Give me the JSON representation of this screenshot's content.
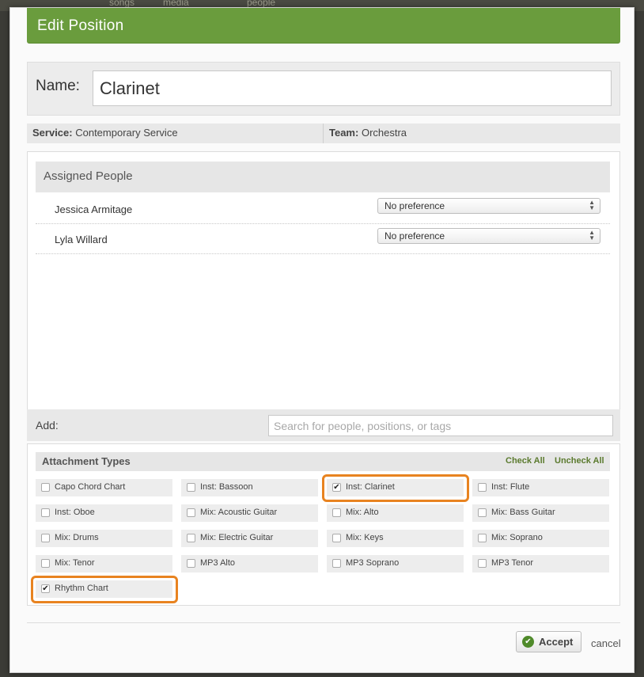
{
  "background": {
    "tabs": [
      "songs",
      "media",
      "people"
    ]
  },
  "dialog": {
    "title": "Edit Position",
    "accent_color": "#6a9c3d",
    "name_label": "Name:",
    "name_value": "Clarinet",
    "service_label": "Service:",
    "service_value": "Contemporary Service",
    "team_label": "Team:",
    "team_value": "Orchestra"
  },
  "assigned": {
    "header": "Assigned People",
    "people": [
      {
        "name": "Jessica Armitage",
        "preference": "No preference"
      },
      {
        "name": "Lyla Willard",
        "preference": "No preference"
      }
    ]
  },
  "add": {
    "label": "Add:",
    "placeholder": "Search for people, positions, or tags"
  },
  "attachments": {
    "title": "Attachment Types",
    "check_all": "Check All",
    "uncheck_all": "Uncheck All",
    "items": [
      {
        "label": "Capo Chord Chart",
        "checked": false
      },
      {
        "label": "Inst: Bassoon",
        "checked": false
      },
      {
        "label": "Inst: Clarinet",
        "checked": true
      },
      {
        "label": "Inst: Flute",
        "checked": false
      },
      {
        "label": "Inst: Oboe",
        "checked": false
      },
      {
        "label": "Mix: Acoustic Guitar",
        "checked": false
      },
      {
        "label": "Mix: Alto",
        "checked": false
      },
      {
        "label": "Mix: Bass Guitar",
        "checked": false
      },
      {
        "label": "Mix: Drums",
        "checked": false
      },
      {
        "label": "Mix: Electric Guitar",
        "checked": false
      },
      {
        "label": "Mix: Keys",
        "checked": false
      },
      {
        "label": "Mix: Soprano",
        "checked": false
      },
      {
        "label": "Mix: Tenor",
        "checked": false
      },
      {
        "label": "MP3 Alto",
        "checked": false
      },
      {
        "label": "MP3 Soprano",
        "checked": false
      },
      {
        "label": "MP3 Tenor",
        "checked": false
      },
      {
        "label": "Rhythm Chart",
        "checked": true
      }
    ],
    "highlight_color": "#e88320"
  },
  "footer": {
    "accept_label": "Accept",
    "accept_icon": "check-circle-icon",
    "cancel_label": "cancel"
  }
}
